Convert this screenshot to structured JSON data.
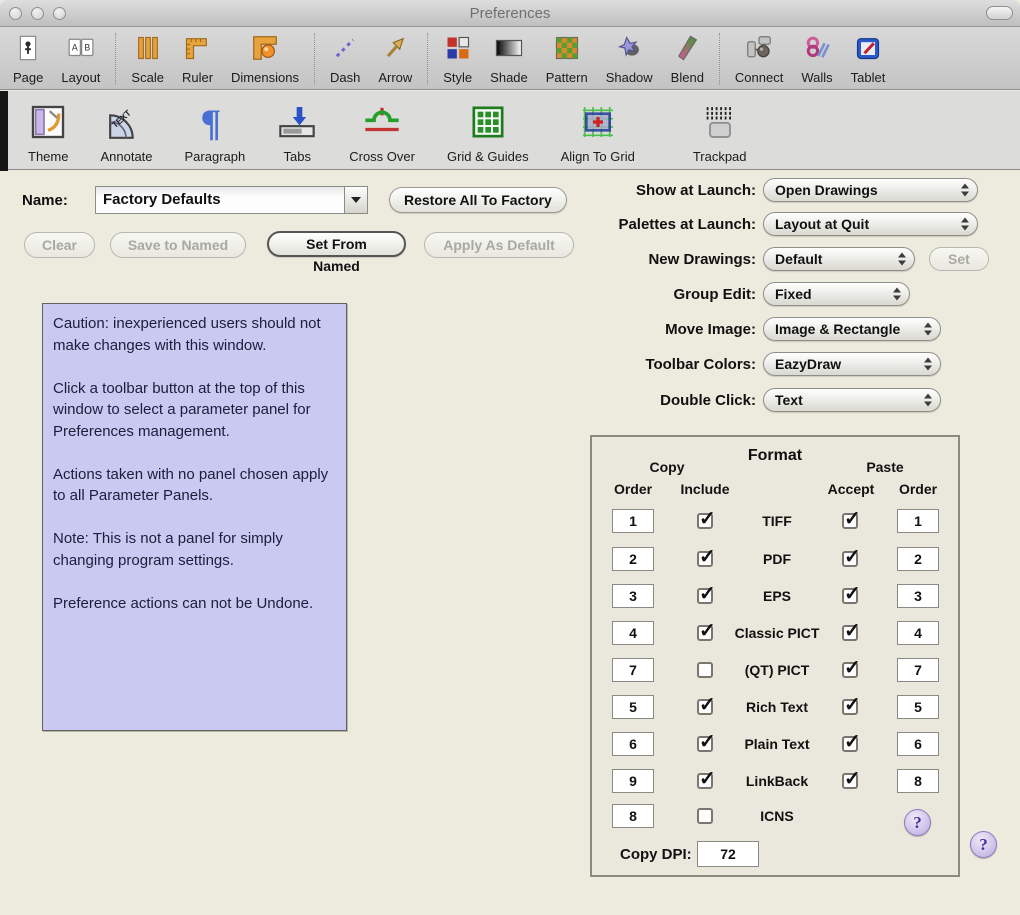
{
  "window": {
    "title": "Preferences"
  },
  "toolbar_main": {
    "groups": [
      {
        "items": [
          {
            "label": "Page",
            "icon": "page-icon"
          },
          {
            "label": "Layout",
            "icon": "layout-icon"
          }
        ]
      },
      {
        "items": [
          {
            "label": "Scale",
            "icon": "scale-icon"
          },
          {
            "label": "Ruler",
            "icon": "ruler-icon"
          },
          {
            "label": "Dimensions",
            "icon": "dimensions-icon"
          }
        ]
      },
      {
        "items": [
          {
            "label": "Dash",
            "icon": "dash-icon"
          },
          {
            "label": "Arrow",
            "icon": "arrow-icon"
          }
        ]
      },
      {
        "items": [
          {
            "label": "Style",
            "icon": "style-icon"
          },
          {
            "label": "Shade",
            "icon": "shade-icon"
          },
          {
            "label": "Pattern",
            "icon": "pattern-icon"
          },
          {
            "label": "Shadow",
            "icon": "shadow-icon"
          },
          {
            "label": "Blend",
            "icon": "blend-icon"
          }
        ]
      },
      {
        "items": [
          {
            "label": "Connect",
            "icon": "connect-icon"
          },
          {
            "label": "Walls",
            "icon": "walls-icon"
          },
          {
            "label": "Tablet",
            "icon": "tablet-icon"
          }
        ]
      }
    ]
  },
  "toolbar_secondary": {
    "items": [
      {
        "label": "Theme",
        "icon": "theme-icon"
      },
      {
        "label": "Annotate",
        "icon": "annotate-icon"
      },
      {
        "label": "Paragraph",
        "icon": "paragraph-icon"
      },
      {
        "label": "Tabs",
        "icon": "tabs-icon"
      },
      {
        "label": "Cross Over",
        "icon": "crossover-icon"
      },
      {
        "label": "Grid & Guides",
        "icon": "grid-guides-icon"
      },
      {
        "label": "Align To Grid",
        "icon": "align-to-grid-icon"
      },
      {
        "label": "Trackpad",
        "icon": "trackpad-icon"
      }
    ]
  },
  "preset_section": {
    "name_label": "Name:",
    "name_value": "Factory Defaults",
    "restore_button": "Restore All To Factory",
    "buttons": [
      {
        "label": "Clear",
        "disabled": true
      },
      {
        "label": "Save to Named",
        "disabled": true
      },
      {
        "label": "Set From Named",
        "disabled": false
      },
      {
        "label": "Apply As Default",
        "disabled": true
      }
    ]
  },
  "caution": {
    "text": "Caution: inexperienced users should not make changes with this window.\n\nClick a toolbar button at the top of this window to select a parameter panel for Preferences management.\n\nActions taken with no panel chosen apply to all Parameter Panels.\n\nNote: This is not a panel for simply changing program settings.\n\nPreference actions can not be Undone."
  },
  "launch_settings": {
    "rows": [
      {
        "label": "Show at Launch:",
        "value": "Open Drawings"
      },
      {
        "label": "Palettes at Launch:",
        "value": "Layout at Quit"
      },
      {
        "label": "New Drawings:",
        "value": "Default",
        "set_button": {
          "label": "Set",
          "disabled": true
        }
      },
      {
        "label": "Group Edit:",
        "value": "Fixed"
      },
      {
        "label": "Move Image:",
        "value": "Image & Rectangle"
      },
      {
        "label": "Toolbar Colors:",
        "value": "EazyDraw"
      },
      {
        "label": "Double Click:",
        "value": "Text"
      }
    ]
  },
  "format_panel": {
    "headers": {
      "format": "Format",
      "copy": "Copy",
      "paste": "Paste",
      "copy_order": "Order",
      "include": "Include",
      "accept": "Accept",
      "paste_order": "Order"
    },
    "rows": [
      {
        "name": "TIFF",
        "copy_order": "1",
        "include": true,
        "accept": true,
        "paste_order": "1"
      },
      {
        "name": "PDF",
        "copy_order": "2",
        "include": true,
        "accept": true,
        "paste_order": "2"
      },
      {
        "name": "EPS",
        "copy_order": "3",
        "include": true,
        "accept": true,
        "paste_order": "3"
      },
      {
        "name": "Classic PICT",
        "copy_order": "4",
        "include": true,
        "accept": true,
        "paste_order": "4"
      },
      {
        "name": "(QT) PICT",
        "copy_order": "7",
        "include": false,
        "accept": true,
        "paste_order": "7"
      },
      {
        "name": "Rich Text",
        "copy_order": "5",
        "include": true,
        "accept": true,
        "paste_order": "5"
      },
      {
        "name": "Plain Text",
        "copy_order": "6",
        "include": true,
        "accept": true,
        "paste_order": "6"
      },
      {
        "name": "LinkBack",
        "copy_order": "9",
        "include": true,
        "accept": true,
        "paste_order": "8"
      },
      {
        "name": "ICNS",
        "copy_order": "8",
        "include": false
      }
    ],
    "copy_dpi_label": "Copy DPI:",
    "copy_dpi_value": "72",
    "help_label": "?"
  },
  "colors": {
    "content_bg": "#edeade",
    "caution_bg": "#c9c9f1",
    "help_purple": "#4a2f9e",
    "toolbar_gray": "#cccccc"
  }
}
